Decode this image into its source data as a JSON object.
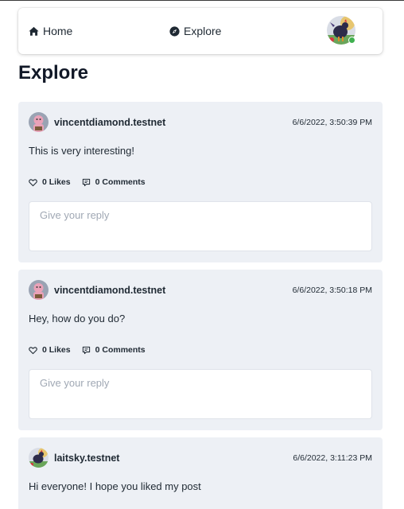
{
  "nav": {
    "home_label": "Home",
    "explore_label": "Explore",
    "home_icon": "home-icon",
    "explore_icon": "compass-icon",
    "status_color": "#3fb04f"
  },
  "page": {
    "title": "Explore"
  },
  "posts": [
    {
      "author": "vincentdiamond.testnet",
      "timestamp": "6/6/2022, 3:50:39 PM",
      "body": "This is very interesting!",
      "likes": "0 Likes",
      "comments": "0 Comments",
      "reply_placeholder": "Give your reply"
    },
    {
      "author": "vincentdiamond.testnet",
      "timestamp": "6/6/2022, 3:50:18 PM",
      "body": "Hey, how do you do?",
      "likes": "0 Likes",
      "comments": "0 Comments",
      "reply_placeholder": "Give your reply"
    },
    {
      "author": "laitsky.testnet",
      "timestamp": "6/6/2022, 3:11:23 PM",
      "body": "Hi everyone! I hope you liked my post"
    }
  ],
  "colors": {
    "card_bg": "#edf0f5",
    "text": "#1f2933"
  }
}
